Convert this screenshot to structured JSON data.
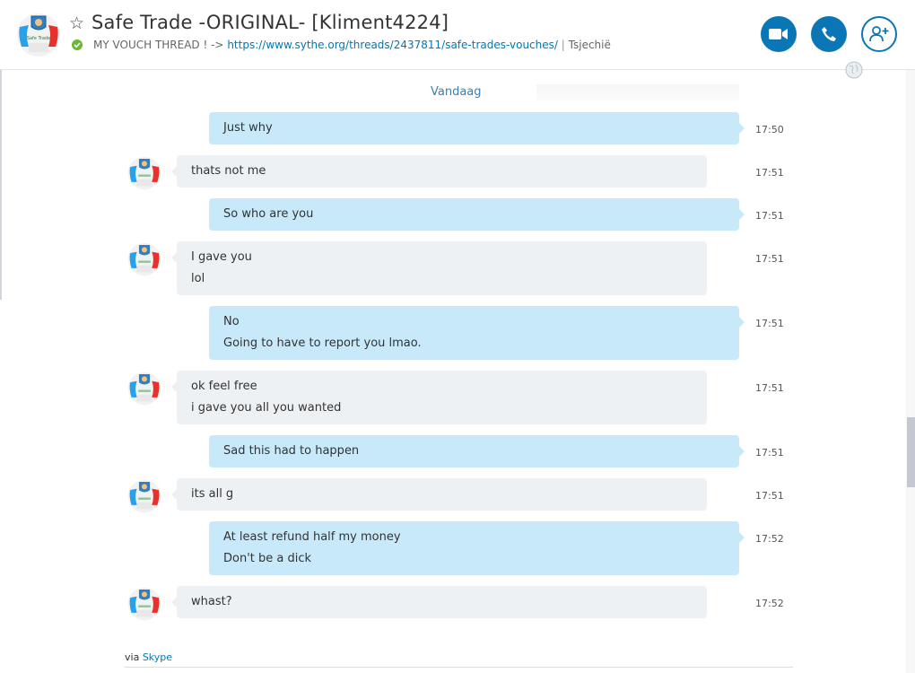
{
  "header": {
    "title": "Safe Trade -ORIGINAL- [Kliment4224]",
    "mood_prefix": "MY VOUCH THREAD ! ->",
    "mood_link": "https://www.sythe.org/threads/2437811/safe-trades-vouches/",
    "mood_sep": "|",
    "location": "Tsjechië",
    "status_color": "#6cb832",
    "avatar_text": "Safe Trade"
  },
  "chat": {
    "date_label": "Vandaag",
    "messages": [
      {
        "dir": "out",
        "lines": [
          "Just why"
        ],
        "time": "17:50"
      },
      {
        "dir": "in",
        "lines": [
          "thats not me"
        ],
        "time": "17:51"
      },
      {
        "dir": "out",
        "lines": [
          "So who are you"
        ],
        "time": "17:51"
      },
      {
        "dir": "in",
        "lines": [
          "I gave you",
          "lol"
        ],
        "time": "17:51"
      },
      {
        "dir": "out",
        "lines": [
          "No",
          "Going to have to report you lmao."
        ],
        "time": "17:51"
      },
      {
        "dir": "in",
        "lines": [
          "ok feel free",
          "i gave you all you wanted"
        ],
        "time": "17:51"
      },
      {
        "dir": "out",
        "lines": [
          "Sad this had to happen"
        ],
        "time": "17:51"
      },
      {
        "dir": "in",
        "lines": [
          "its all g"
        ],
        "time": "17:51"
      },
      {
        "dir": "out",
        "lines": [
          "At least refund half my money",
          "Don't be a dick"
        ],
        "time": "17:52"
      },
      {
        "dir": "in",
        "lines": [
          "whast?"
        ],
        "time": "17:52"
      }
    ]
  },
  "footer": {
    "via": "via",
    "via_link": "Skype"
  },
  "colors": {
    "accent": "#0b76b5",
    "outgoing_bubble": "#c7e9f9",
    "incoming_bubble": "#eef1f4"
  },
  "icons": [
    "star-icon",
    "video-call-icon",
    "phone-call-icon",
    "add-contact-icon",
    "globe-icon",
    "online-status-icon"
  ]
}
